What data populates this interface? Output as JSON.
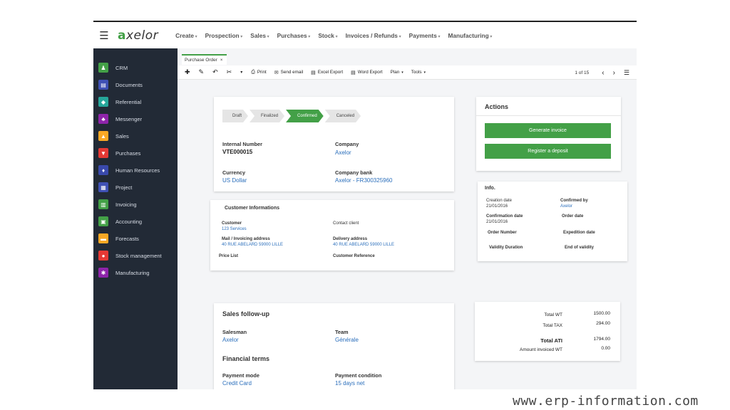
{
  "logo": "axelor",
  "menu": [
    "Create",
    "Prospection",
    "Sales",
    "Purchases",
    "Stock",
    "Invoices / Refunds",
    "Payments",
    "Manufacturing"
  ],
  "sidebar": [
    {
      "label": "CRM",
      "icon": "user-icon",
      "color": "#43a047"
    },
    {
      "label": "Documents",
      "icon": "document-icon",
      "color": "#3f51b5"
    },
    {
      "label": "Referential",
      "icon": "cube-icon",
      "color": "#26a69a"
    },
    {
      "label": "Messenger",
      "icon": "users-icon",
      "color": "#8e24aa"
    },
    {
      "label": "Sales",
      "icon": "chart-icon",
      "color": "#f9a825"
    },
    {
      "label": "Purchases",
      "icon": "cart-icon",
      "color": "#e53935"
    },
    {
      "label": "Human Resources",
      "icon": "org-icon",
      "color": "#3949ab"
    },
    {
      "label": "Project",
      "icon": "project-icon",
      "color": "#3f51b5"
    },
    {
      "label": "Invoicing",
      "icon": "invoice-icon",
      "color": "#43a047"
    },
    {
      "label": "Accounting",
      "icon": "calculator-icon",
      "color": "#43a047"
    },
    {
      "label": "Forecasts",
      "icon": "forecast-icon",
      "color": "#f9a825"
    },
    {
      "label": "Stock management",
      "icon": "stock-icon",
      "color": "#e53935"
    },
    {
      "label": "Manufacturing",
      "icon": "gears-icon",
      "color": "#8e24aa"
    }
  ],
  "tab": {
    "label": "Purchase Order",
    "close": "×"
  },
  "toolbar": {
    "print": "Print",
    "send_email": "Send email",
    "excel_export": "Excel Export",
    "word_export": "Word Export",
    "plan": "Plan",
    "tools": "Tools",
    "pager": "1 of 15"
  },
  "status_steps": [
    {
      "label": "Draft",
      "active": false
    },
    {
      "label": "Finalized",
      "active": false
    },
    {
      "label": "Confirmed",
      "active": true
    },
    {
      "label": "Canceled",
      "active": false
    }
  ],
  "order": {
    "internal_number_label": "Internal Number",
    "internal_number": "VTE000015",
    "company_label": "Company",
    "company": "Axelor",
    "currency_label": "Currency",
    "currency": "US Dollar",
    "company_bank_label": "Company bank",
    "company_bank": "Axelor - FR300325960"
  },
  "customer": {
    "title": "Customer Informations",
    "customer_label": "Customer",
    "customer": "123 Services",
    "contact_label": "Contact client",
    "mail_label": "Mail / Invoicing address",
    "mail": "40 RUE ABELARD 59000 LILLE",
    "delivery_label": "Delivery address",
    "delivery": "40 RUE ABELARD 59000 LILLE",
    "price_list_label": "Price List",
    "customer_ref_label": "Customer Reference"
  },
  "sales_followup": {
    "title": "Sales follow-up",
    "salesman_label": "Salesman",
    "salesman": "Axelor",
    "team_label": "Team",
    "team": "Générale",
    "financial_title": "Financial terms",
    "payment_mode_label": "Payment mode",
    "payment_mode": "Credit Card",
    "payment_condition_label": "Payment condition",
    "payment_condition": "15 days net"
  },
  "actions": {
    "title": "Actions",
    "generate_invoice": "Generate invoice",
    "register_deposit": "Register a deposit"
  },
  "info": {
    "title": "Info.",
    "creation_date_label": "Creation date",
    "creation_date": "21/01/2016",
    "confirmed_by_label": "Confirmed by",
    "confirmed_by": "Axelor",
    "confirmation_date_label": "Confirmation date",
    "confirmation_date": "21/01/2016",
    "order_date_label": "Order date",
    "order_number_label": "Order Number",
    "expedition_date_label": "Expedition date",
    "validity_label": "Validity Duration",
    "end_validity_label": "End of validity"
  },
  "totals": {
    "total_wt_label": "Total WT",
    "total_wt": "1500.00",
    "total_tax_label": "Total TAX",
    "total_tax": "294.00",
    "total_ati_label": "Total ATI",
    "total_ati": "1794.00",
    "invoiced_label": "Amount invoiced WT",
    "invoiced": "0.00"
  },
  "watermark": "www.erp-information.com",
  "colors": {
    "accent": "#43a047",
    "sidebar": "#222a36",
    "link": "#2a6ebb"
  }
}
